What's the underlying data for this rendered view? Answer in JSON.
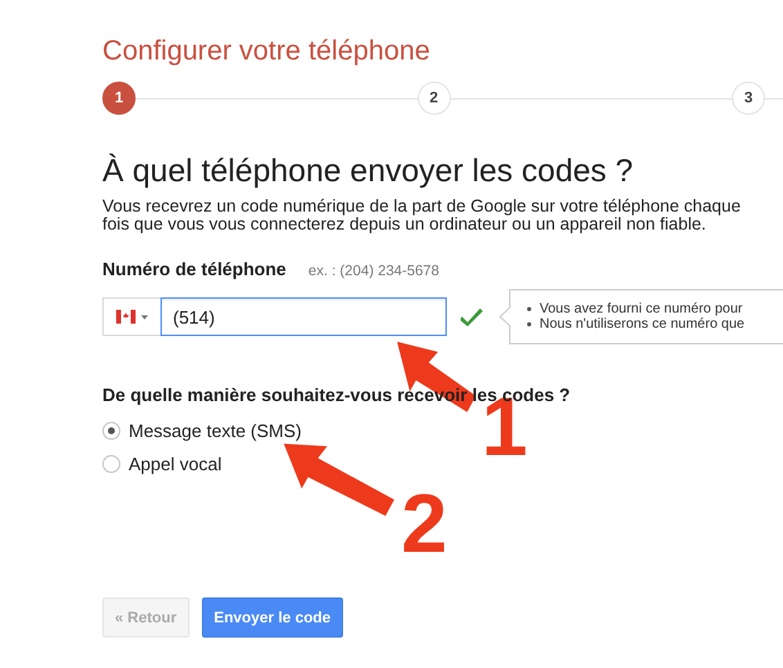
{
  "title": "Configurer votre téléphone",
  "steps": [
    {
      "label": "1",
      "selected": true
    },
    {
      "label": "2",
      "selected": false
    },
    {
      "label": "3",
      "selected": false
    }
  ],
  "heading": "À quel téléphone envoyer les codes ?",
  "description": "Vous recevrez un code numérique de la part de Google sur votre téléphone chaque fois que vous vous connecterez depuis un ordinateur ou un appareil non fiable.",
  "phone": {
    "label": "Numéro de téléphone",
    "example": "ex. : (204) 234-5678",
    "value": "(514)",
    "valid": true
  },
  "tooltip": [
    "Vous avez fourni ce numéro pour",
    "Nous n'utiliserons ce numéro que"
  ],
  "question": "De quelle manière souhaitez-vous recevoir les codes ?",
  "options": [
    {
      "label": "Message texte (SMS)",
      "selected": true
    },
    {
      "label": "Appel vocal",
      "selected": false
    }
  ],
  "buttons": [
    {
      "label": "« Retour",
      "kind": "secondary"
    },
    {
      "label": "Envoyer le code",
      "kind": "primary"
    }
  ],
  "annotations": [
    {
      "label": "1"
    },
    {
      "label": "2"
    }
  ]
}
